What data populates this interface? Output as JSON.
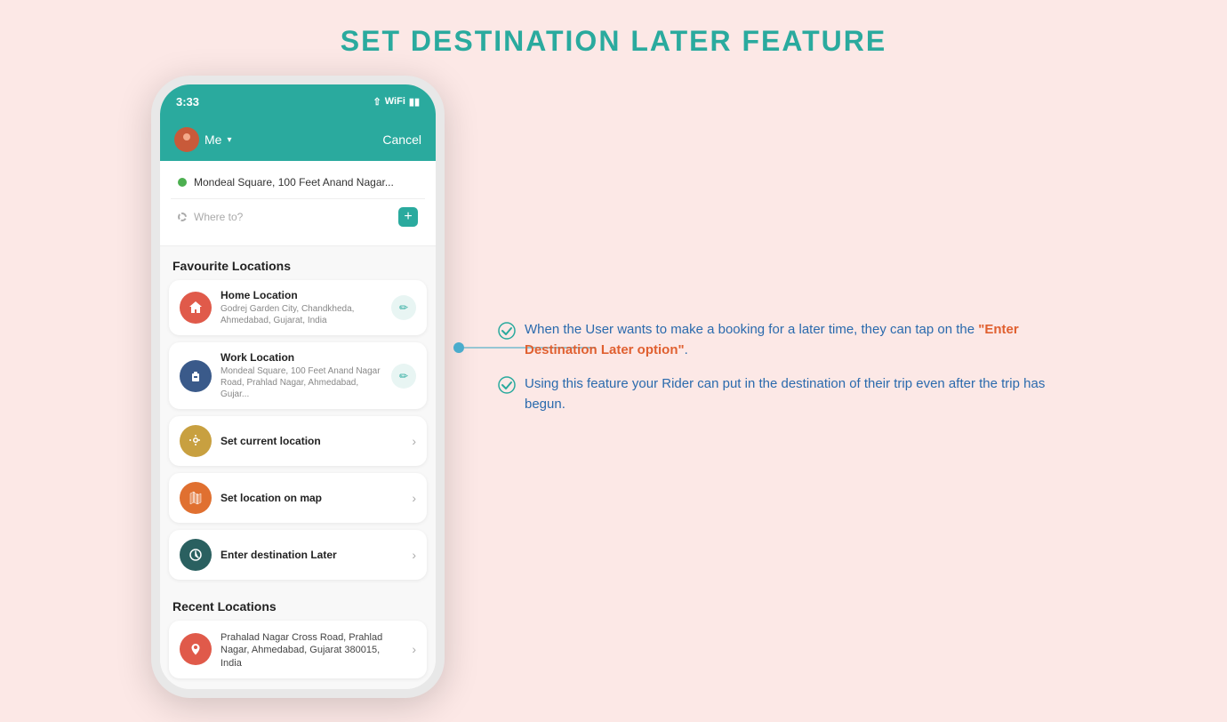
{
  "page": {
    "title": "SET DESTINATION LATER FEATURE",
    "background": "#fce8e6"
  },
  "phone": {
    "status_time": "3:33",
    "header": {
      "user": "Me",
      "cancel": "Cancel"
    },
    "search": {
      "origin": "Mondeal Square, 100 Feet Anand Nagar...",
      "destination_placeholder": "Where to?"
    },
    "sections": [
      {
        "title": "Favourite Locations",
        "items": [
          {
            "icon_type": "home",
            "icon_symbol": "🏠",
            "name": "Home Location",
            "address": "Godrej Garden City, Chandkheda, Ahmedabad, Gujarat, India",
            "action": "edit"
          },
          {
            "icon_type": "work",
            "icon_symbol": "💼",
            "name": "Work Location",
            "address": "Mondeal Square, 100 Feet Anand Nagar Road, Prahlad Nagar, Ahmedabad, Gujar...",
            "action": "edit"
          }
        ]
      },
      {
        "title": "",
        "items": [
          {
            "icon_type": "current",
            "icon_symbol": "📍",
            "name": "Set current location",
            "address": "",
            "action": "chevron"
          },
          {
            "icon_type": "map",
            "icon_symbol": "🗺",
            "name": "Set location on map",
            "address": "",
            "action": "chevron"
          },
          {
            "icon_type": "later",
            "icon_symbol": "🕐",
            "name": "Enter destination Later",
            "address": "",
            "action": "chevron"
          }
        ]
      },
      {
        "title": "Recent Locations",
        "items": [
          {
            "icon_type": "recent",
            "icon_symbol": "📍",
            "name": "",
            "address": "Prahalad Nagar Cross Road, Prahlad Nagar, Ahmedabad, Gujarat 380015, India",
            "action": "chevron"
          }
        ]
      }
    ]
  },
  "info_panel": {
    "bullets": [
      {
        "text": "When the User wants to make a booking for a later time, they can tap on the \"Enter Destination Later option\"."
      },
      {
        "text": "Using this feature your Rider can put in the destination of their trip even after the trip has begun."
      }
    ]
  }
}
